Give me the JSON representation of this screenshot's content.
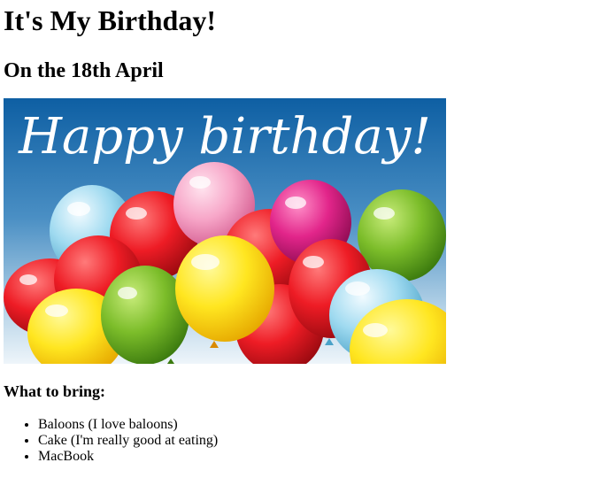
{
  "page": {
    "title": "It's My Birthday!",
    "subtitle": "On the 18th April",
    "banner": {
      "text": "Happy birthday!",
      "sky_top": "#0e5fa3",
      "sky_bottom": "#e8f2f8"
    },
    "bring_heading": "What to bring:",
    "bring_items": [
      "Baloons (I love baloons)",
      "Cake (I'm really good at eating)",
      "MacBook"
    ]
  }
}
